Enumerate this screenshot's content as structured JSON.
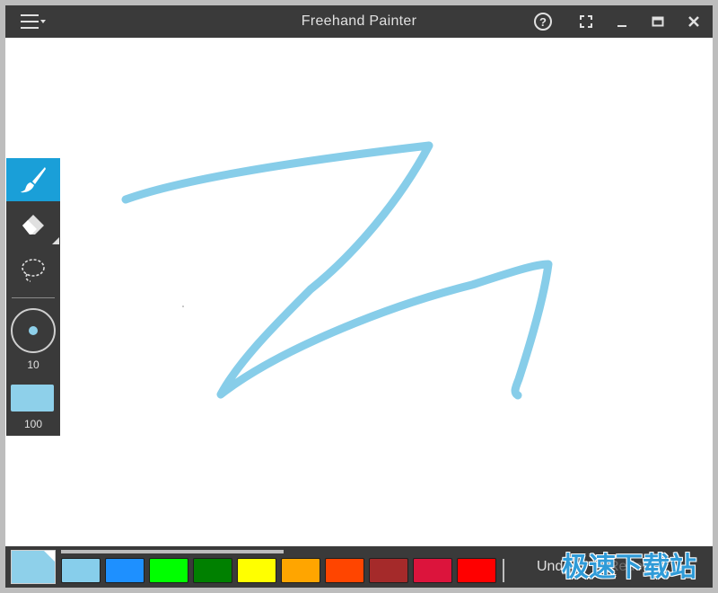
{
  "window": {
    "title": "Freehand Painter",
    "accent_color": "#1a9fd8",
    "titlebar_buttons": [
      "help-icon",
      "fullscreen-icon",
      "minimize-icon",
      "maximize-icon",
      "close-icon"
    ]
  },
  "tools": {
    "items": [
      {
        "name": "brush",
        "icon": "brush-icon",
        "active": true
      },
      {
        "name": "eraser",
        "icon": "eraser-icon",
        "active": false
      },
      {
        "name": "lasso",
        "icon": "lasso-icon",
        "active": false
      }
    ],
    "brush_size": "10",
    "opacity": "100",
    "current_color": "#8ed0ea"
  },
  "canvas": {
    "stroke_color": "#87cde9"
  },
  "palette": {
    "swatches": [
      "#87ceeb",
      "#1e90ff",
      "#00ff00",
      "#008000",
      "#ffff00",
      "#ffa500",
      "#ff4500",
      "#a52a2a",
      "#dc143c",
      "#ff0000"
    ]
  },
  "actions": {
    "undo_label": "Undo",
    "redo_label": "Redo"
  },
  "watermark": {
    "text": "极速下载站"
  }
}
